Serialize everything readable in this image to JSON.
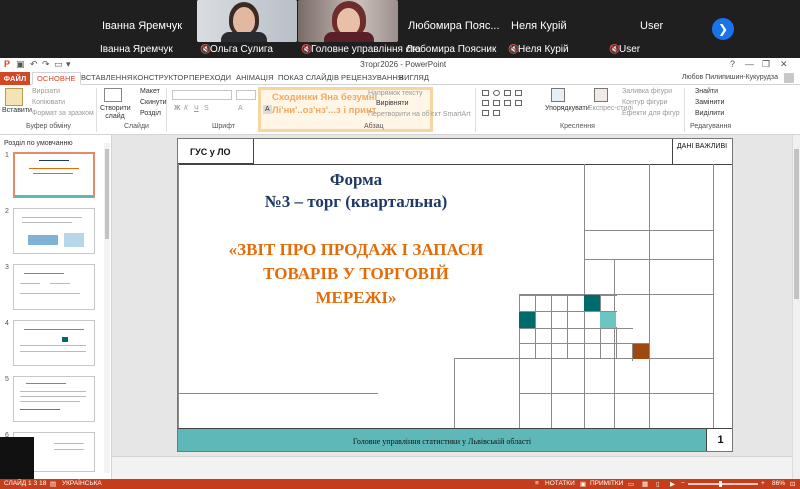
{
  "call": {
    "participants": [
      {
        "name": "Іванна Яремчук",
        "label": "Іванна Яремчук",
        "muted": false
      },
      {
        "name": "",
        "label": "Ольга Сулига",
        "muted": true
      },
      {
        "name": "",
        "label": "Головне управління ста",
        "muted": true
      },
      {
        "name": "Любомира Пояс...",
        "label": "Любомира Поясник",
        "muted": false
      },
      {
        "name": "Неля Курій",
        "label": "Неля Курій",
        "muted": true
      },
      {
        "name": "User",
        "label": "User",
        "muted": true
      }
    ],
    "next_icon": "chevron-right-icon"
  },
  "titlebar": {
    "title": "Зторг2026 - PowerPoint",
    "controls": [
      "?",
      "—",
      "❐",
      "✕"
    ]
  },
  "ribbon_tabs": {
    "file": "ФАЙЛ",
    "tabs": [
      "ОСНОВНЕ",
      "ВСТАВЛЕННЯ",
      "КОНСТРУКТОР",
      "ПЕРЕХОДИ",
      "АНІМАЦІЯ",
      "ПОКАЗ СЛАЙДІВ",
      "РЕЦЕНЗУВАННЯ",
      "ВИГЛЯД"
    ],
    "active": "ОСНОВНЕ",
    "user": "Любов Пилипишин-Кукурудза"
  },
  "ribbon": {
    "clipboard": {
      "paste": "Вставити",
      "cut": "Вирізати",
      "copy": "Копіювати",
      "format": "Формат за зразком",
      "label": "Буфер обміну"
    },
    "slides": {
      "new": "Створити слайд",
      "layout": "Макет",
      "reset": "Скинути",
      "section": "Розділ",
      "label": "Слайди"
    },
    "font": {
      "label": "Шрифт"
    },
    "paragraph": {
      "label": "Абзац",
      "direction": "Напрямок тексту",
      "align": "Вирівняти",
      "smartart": "Перетворити на об'єкт SmartArt"
    },
    "drawing": {
      "arrange": "Упорядкувати",
      "styles": "Експрес-стилі",
      "fill": "Заливка фігури",
      "outline": "Контур фігури",
      "effects": "Ефекти для фігур",
      "label": "Креслення"
    },
    "editing": {
      "find": "Знайти",
      "replace": "Замінити",
      "select": "Виділити",
      "label": "Редагування"
    },
    "overlay_lines": [
      "Сходинки Яна безумні",
      "Лі'ни'..оз'нз'...з і принт"
    ]
  },
  "left_panel": {
    "section": "Розділ по умовчанню",
    "slides": [
      "1",
      "2",
      "3",
      "4",
      "5",
      "6"
    ]
  },
  "slide": {
    "header_left": "ГУС у ЛО",
    "header_right": "ДАНІ ВАЖЛИВІ",
    "form_title_1": "Форма",
    "form_title_2": "№3 – торг (квартальна)",
    "report_title_1": "«ЗВІТ ПРО ПРОДАЖ І ЗАПАСИ",
    "report_title_2": "ТОВАРІВ У ТОРГОВІЙ",
    "report_title_3": "МЕРЕЖІ»",
    "footer": "Головне управління статистики у Львівській області",
    "page": "1",
    "colors": {
      "teal_dark": "#006b6b",
      "teal_light": "#6cc5c5",
      "brown": "#9c4a12",
      "footer": "#5fb8b8",
      "title_blue": "#1f3864",
      "title_orange": "#e36c0a"
    }
  },
  "statusbar": {
    "slide": "СЛАЙД 1 З 18",
    "lang": "УКРАЇНСЬКА",
    "notes": "НОТАТКИ",
    "comments": "ПРИМІТКИ",
    "zoom": "86%"
  }
}
